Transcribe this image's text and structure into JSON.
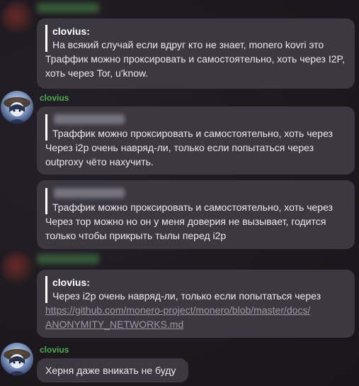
{
  "messages": {
    "m1": {
      "quote_author": "clovius:",
      "quote_text": "На всякий случай если вдруг кто не знает, monero kovri это",
      "text": "Траффик можно проксировать и самостоятельно, хоть через I2P, хоть через Tor, u'know."
    },
    "m2": {
      "sender": "clovius",
      "quote_text": "Траффик можно проксировать и самостоятельно, хоть через",
      "text": "Через i2p очень навряд-ли, только если попытаться через outproxy чёто нахучить."
    },
    "m3": {
      "quote_text": "Траффик можно проксировать и самостоятельно, хоть через",
      "text": "Через тор можно но он у меня доверия не вызывает, годится только чтобы прикрыть тылы перед i2p"
    },
    "m4": {
      "quote_author": "clovius:",
      "quote_text": "Через i2p очень навряд-ли, только если попытаться через",
      "link_line1": "https://github.com/monero-project/monero/blob/master/docs/",
      "link_line2": "ANONYMITY_NETWORKS.md"
    },
    "m5": {
      "sender": "clovius",
      "text": "Херня даже вникать не буду"
    }
  }
}
